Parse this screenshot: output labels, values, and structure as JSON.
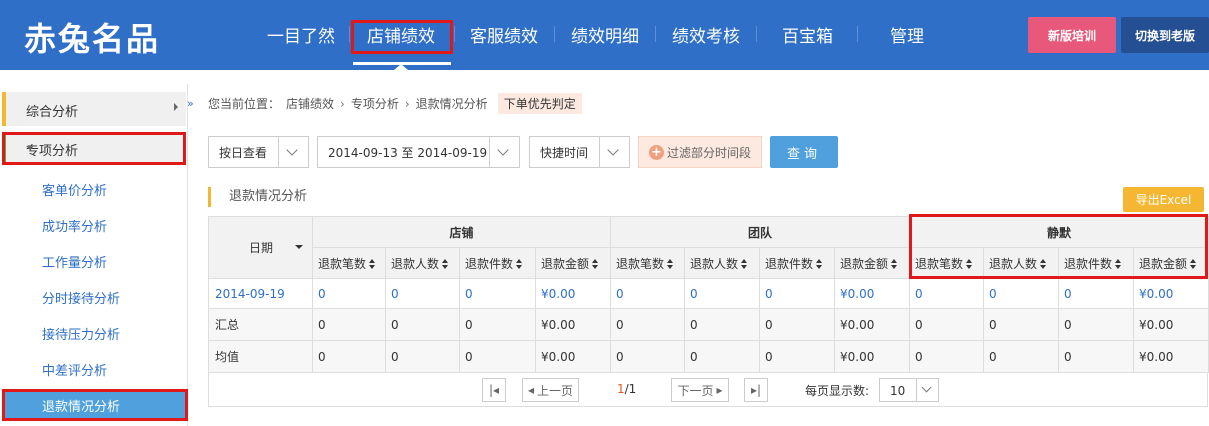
{
  "header": {
    "logo": "赤兔名品",
    "nav": [
      "一目了然",
      "店铺绩效",
      "客服绩效",
      "绩效明细",
      "绩效考核",
      "百宝箱",
      "管理"
    ],
    "active_nav": "店铺绩效",
    "btn_training": "新版培训",
    "btn_switch_old": "切换到老版"
  },
  "sidebar": {
    "collapse_icon": "»",
    "group1": "综合分析",
    "group2": "专项分析",
    "items": [
      "客单价分析",
      "成功率分析",
      "工作量分析",
      "分时接待分析",
      "接待压力分析",
      "中差评分析",
      "退款情况分析"
    ],
    "active_item": "退款情况分析"
  },
  "breadcrumb": {
    "prefix": "您当前位置：",
    "path": [
      "店铺绩效",
      "专项分析",
      "退款情况分析"
    ],
    "tag": "下单优先判定"
  },
  "filters": {
    "view_mode": "按日查看",
    "date_range": "2014-09-13 至 2014-09-19",
    "quick_time": "快捷时间",
    "filter_btn": "过滤部分时间段",
    "query_btn": "查询"
  },
  "section": {
    "title": "退款情况分析",
    "export_btn": "导出Excel"
  },
  "table": {
    "date_header": "日期",
    "groups": [
      "店铺",
      "团队",
      "静默"
    ],
    "sub_headers": [
      "退款笔数",
      "退款人数",
      "退款件数",
      "退款金额"
    ],
    "rows": [
      {
        "label": "2014-09-19",
        "cells": [
          "0",
          "0",
          "0",
          "¥0.00",
          "0",
          "0",
          "0",
          "¥0.00",
          "0",
          "0",
          "0",
          "¥0.00"
        ]
      },
      {
        "label": "汇总",
        "cells": [
          "0",
          "0",
          "0",
          "¥0.00",
          "0",
          "0",
          "0",
          "¥0.00",
          "0",
          "0",
          "0",
          "¥0.00"
        ]
      },
      {
        "label": "均值",
        "cells": [
          "0",
          "0",
          "0",
          "¥0.00",
          "0",
          "0",
          "0",
          "¥0.00",
          "0",
          "0",
          "0",
          "¥0.00"
        ]
      }
    ]
  },
  "pagination": {
    "prev": "上一页",
    "next": "下一页",
    "current": "1",
    "total": "/1",
    "per_page_label": "每页显示数:",
    "per_page": "10"
  },
  "colors": {
    "header_bg": "#2f6fc7",
    "accent_red": "#e01818",
    "active_blue": "#4fa0dc",
    "export_yellow": "#f5b731",
    "training_pink": "#e8587a"
  }
}
